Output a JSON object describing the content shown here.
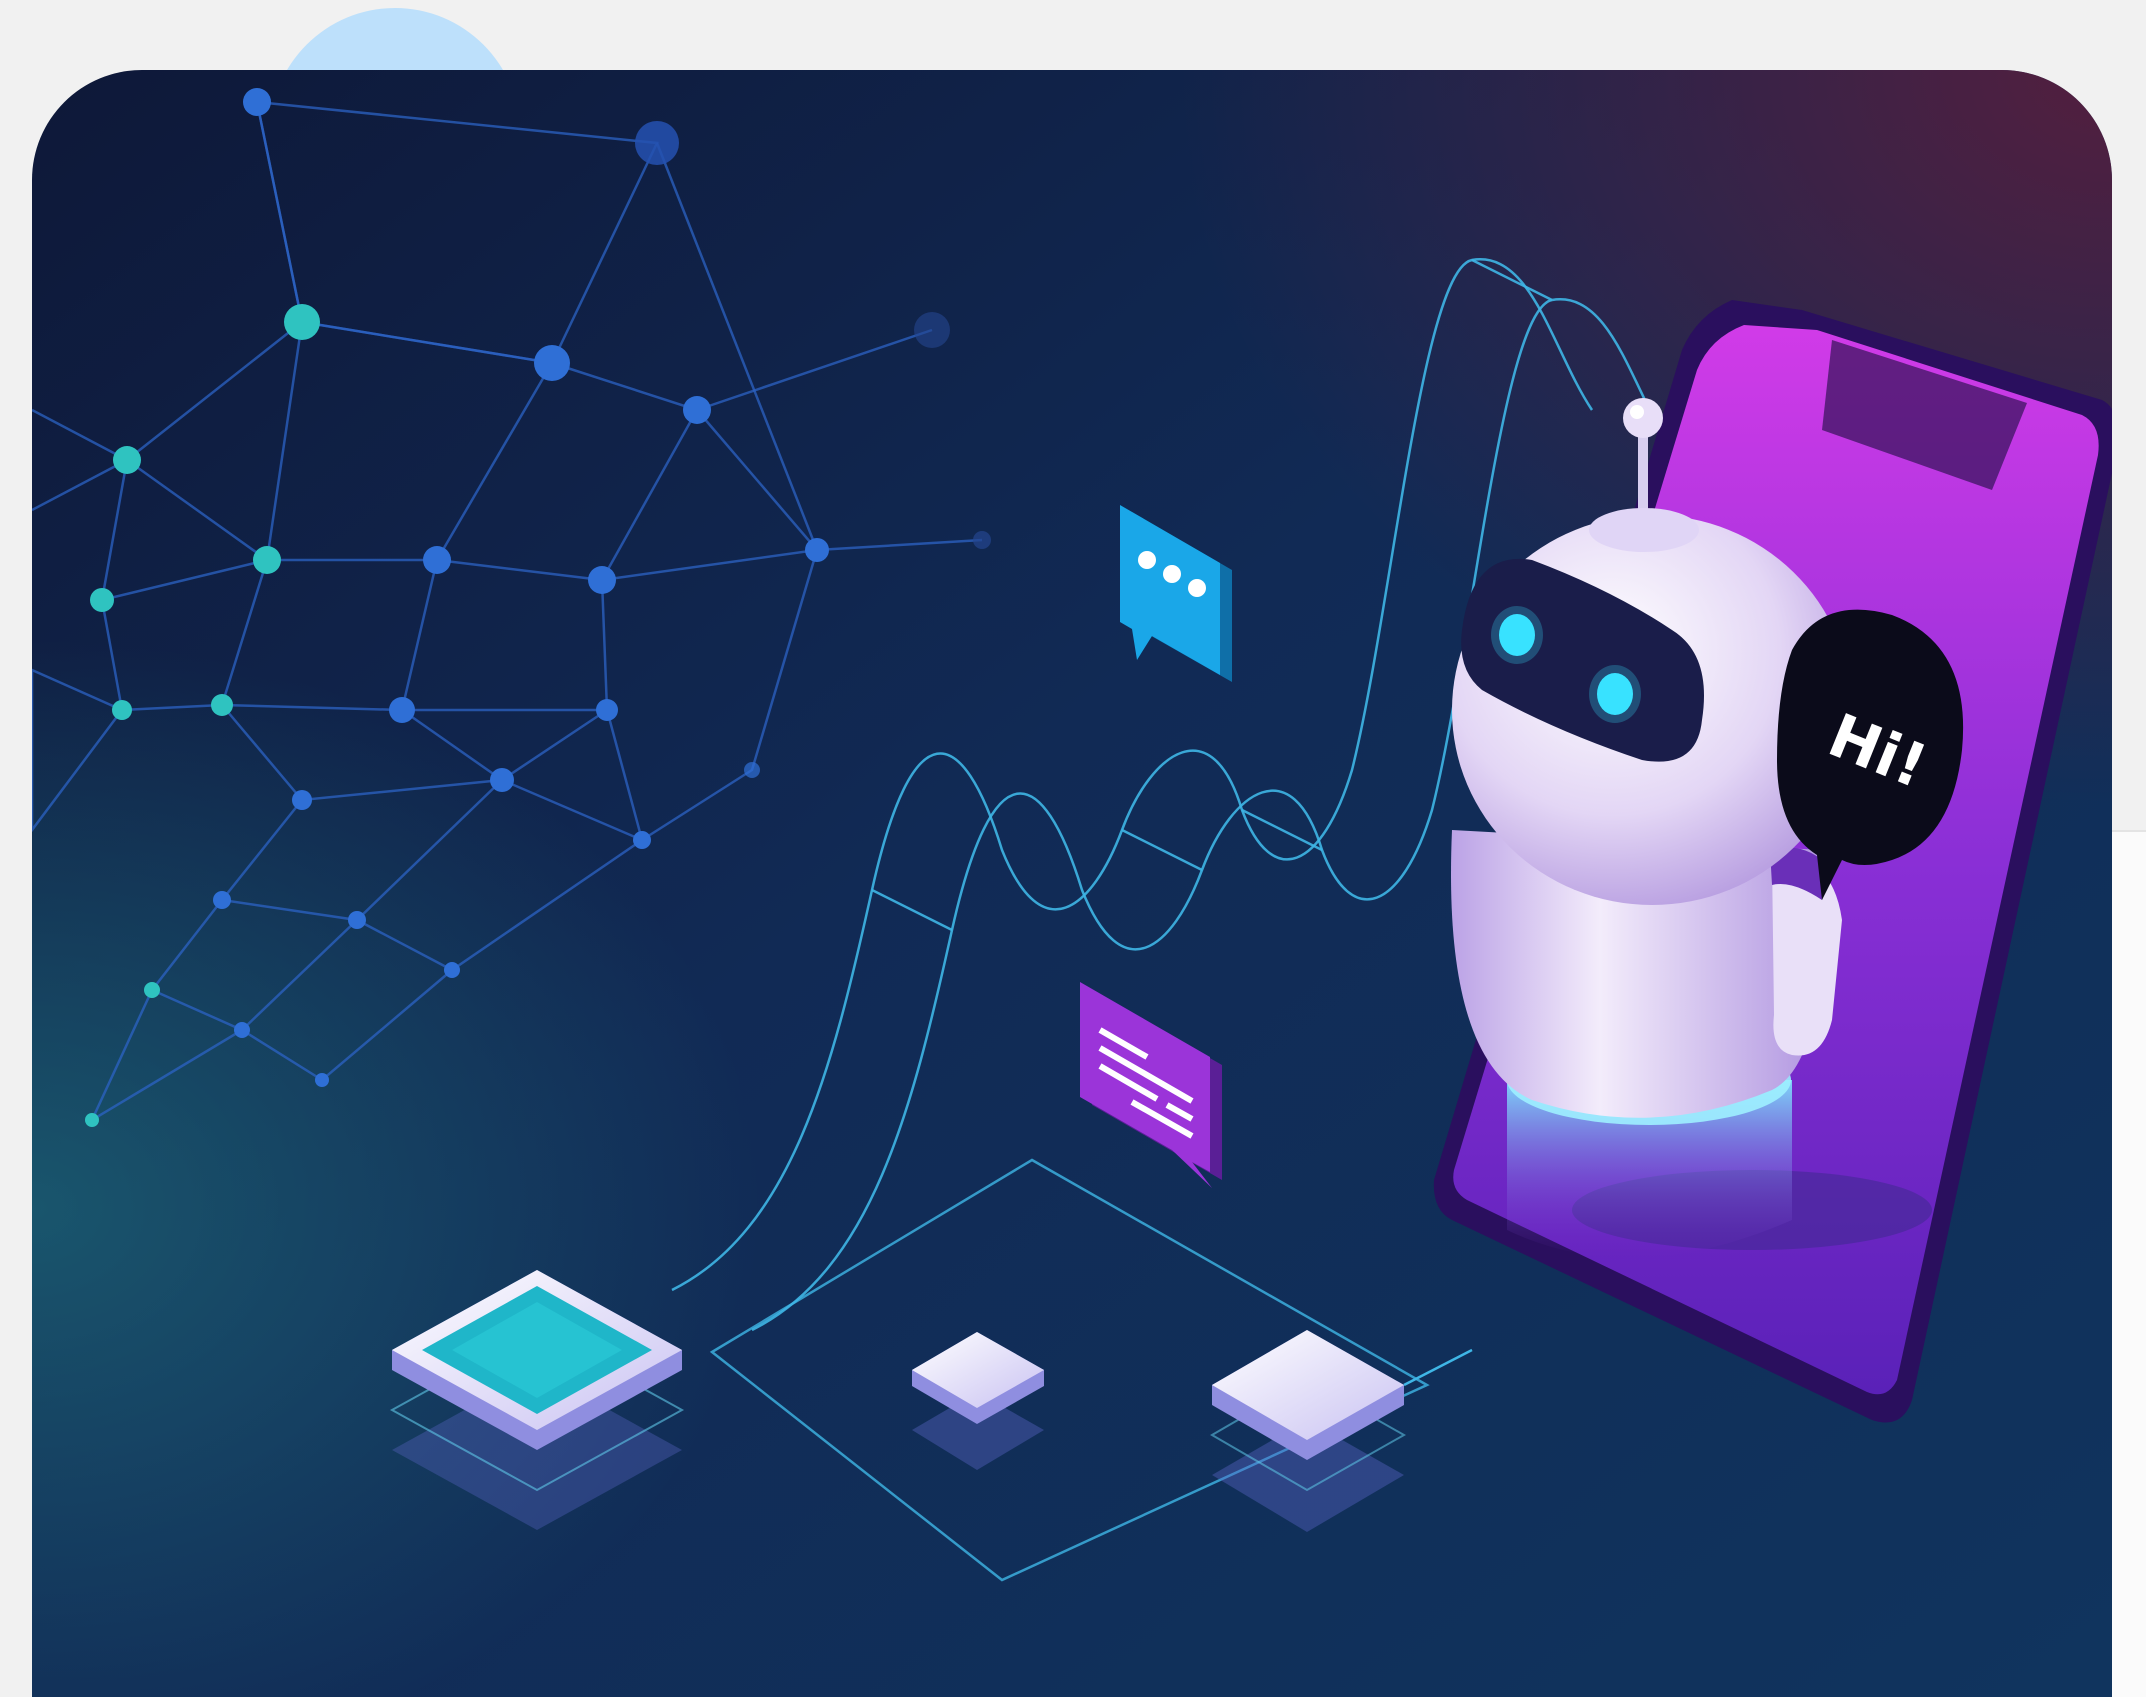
{
  "illustration": {
    "speech_bubble_text": "Hi!",
    "colors": {
      "page_background": "#f1f1f1",
      "accent_blob": "#bde0fb",
      "card_dark": "#0d1b3e",
      "card_mid": "#133a63",
      "network_node": "#2f6fd6",
      "network_node_teal": "#2fc3c0",
      "line_cyan": "#3fb6e6",
      "robot_body": "#e7dcf6",
      "robot_visor": "#1a1d4a",
      "robot_eye": "#38e2ff",
      "phone_purple": "#7b2cc9",
      "chat_blue": "#1aa7e8",
      "chat_purple": "#9b34d9"
    }
  }
}
